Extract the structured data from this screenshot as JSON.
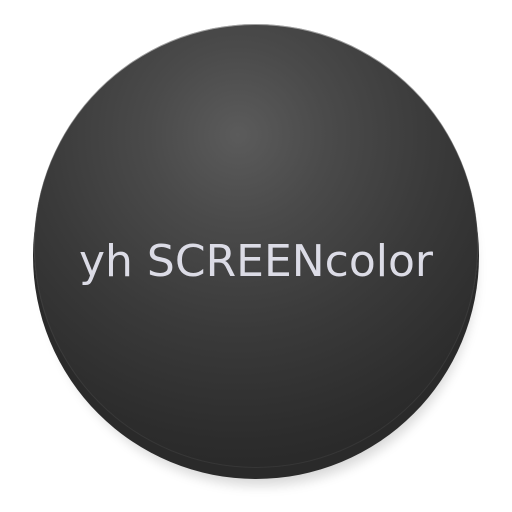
{
  "icon": {
    "label": "yh SCREENcolor",
    "colors": {
      "disc_center": "#5b5b5b",
      "disc_edge": "#232323",
      "text": "#dcdce6",
      "background": "#ffffff"
    }
  }
}
